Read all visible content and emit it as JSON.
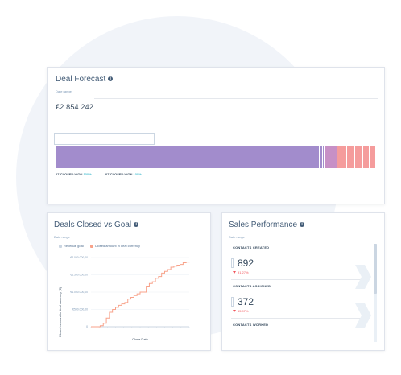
{
  "deal_forecast": {
    "title": "Deal Forecast",
    "date_range": "Date range",
    "amount": "€2.854.242",
    "stage_labels": [
      {
        "name": "07-CLOSED WON",
        "pct": "100%"
      },
      {
        "name": "07-CLOSED WON",
        "pct": "100%"
      }
    ],
    "segment_colors": [
      "#a28ccc",
      "#a28ccc",
      "#a28ccc",
      "#a28ccc",
      "#a28ccc",
      "#c790c6",
      "#f59c9c",
      "#f59c9c",
      "#f59c9c",
      "#f59c9c",
      "#f59c9c"
    ]
  },
  "deals_closed": {
    "title": "Deals Closed vs Goal",
    "date_range": "Date range",
    "legend": [
      {
        "label": "Revenue goal",
        "color": "#cbd6e2"
      },
      {
        "label": "Closed amount in deal currency",
        "color": "#f8a28a"
      }
    ],
    "y_ticks": [
      "€2.000.000,00",
      "€1.500.000,00",
      "€1.000.000,00",
      "€500.000,00",
      "0"
    ],
    "y_axis_label": "Closed amount in deal currency (€)",
    "x_axis_label": "Close Date"
  },
  "chart_data": {
    "type": "line",
    "title": "Deals Closed vs Goal",
    "xlabel": "Close Date",
    "ylabel": "Closed amount in deal currency (€)",
    "ylim": [
      0,
      2000000
    ],
    "series": [
      {
        "name": "Closed amount in deal currency",
        "color": "#f8a28a",
        "values": [
          0,
          0,
          0,
          30000,
          100000,
          250000,
          420000,
          500000,
          560000,
          620000,
          660000,
          700000,
          800000,
          850000,
          900000,
          950000,
          1000000,
          1000000,
          1150000,
          1250000,
          1300000,
          1400000,
          1450000,
          1550000,
          1600000,
          1650000,
          1720000,
          1750000,
          1780000,
          1800000,
          1850000,
          1870000,
          1880000
        ]
      },
      {
        "name": "Revenue goal",
        "color": "#cbd6e2",
        "values": [
          0,
          0,
          0,
          0,
          0,
          0,
          0,
          0,
          0,
          0,
          0,
          0,
          0,
          0,
          0,
          0,
          0,
          0,
          0,
          0,
          0,
          0,
          0,
          0,
          0,
          0,
          0,
          0,
          0,
          0,
          0,
          0,
          0
        ]
      }
    ],
    "grid": true,
    "legend": "top-left"
  },
  "sales_performance": {
    "title": "Sales Performance",
    "date_range": "Date range",
    "kpis": [
      {
        "label": "CONTACTS CREATED",
        "value": "892",
        "change": "91.27%"
      },
      {
        "label": "CONTACTS ASSIGNED",
        "value": "372",
        "change": "65.97%"
      },
      {
        "label": "CONTACTS WORKED",
        "value": "",
        "change": ""
      }
    ]
  },
  "info_glyph": "i"
}
